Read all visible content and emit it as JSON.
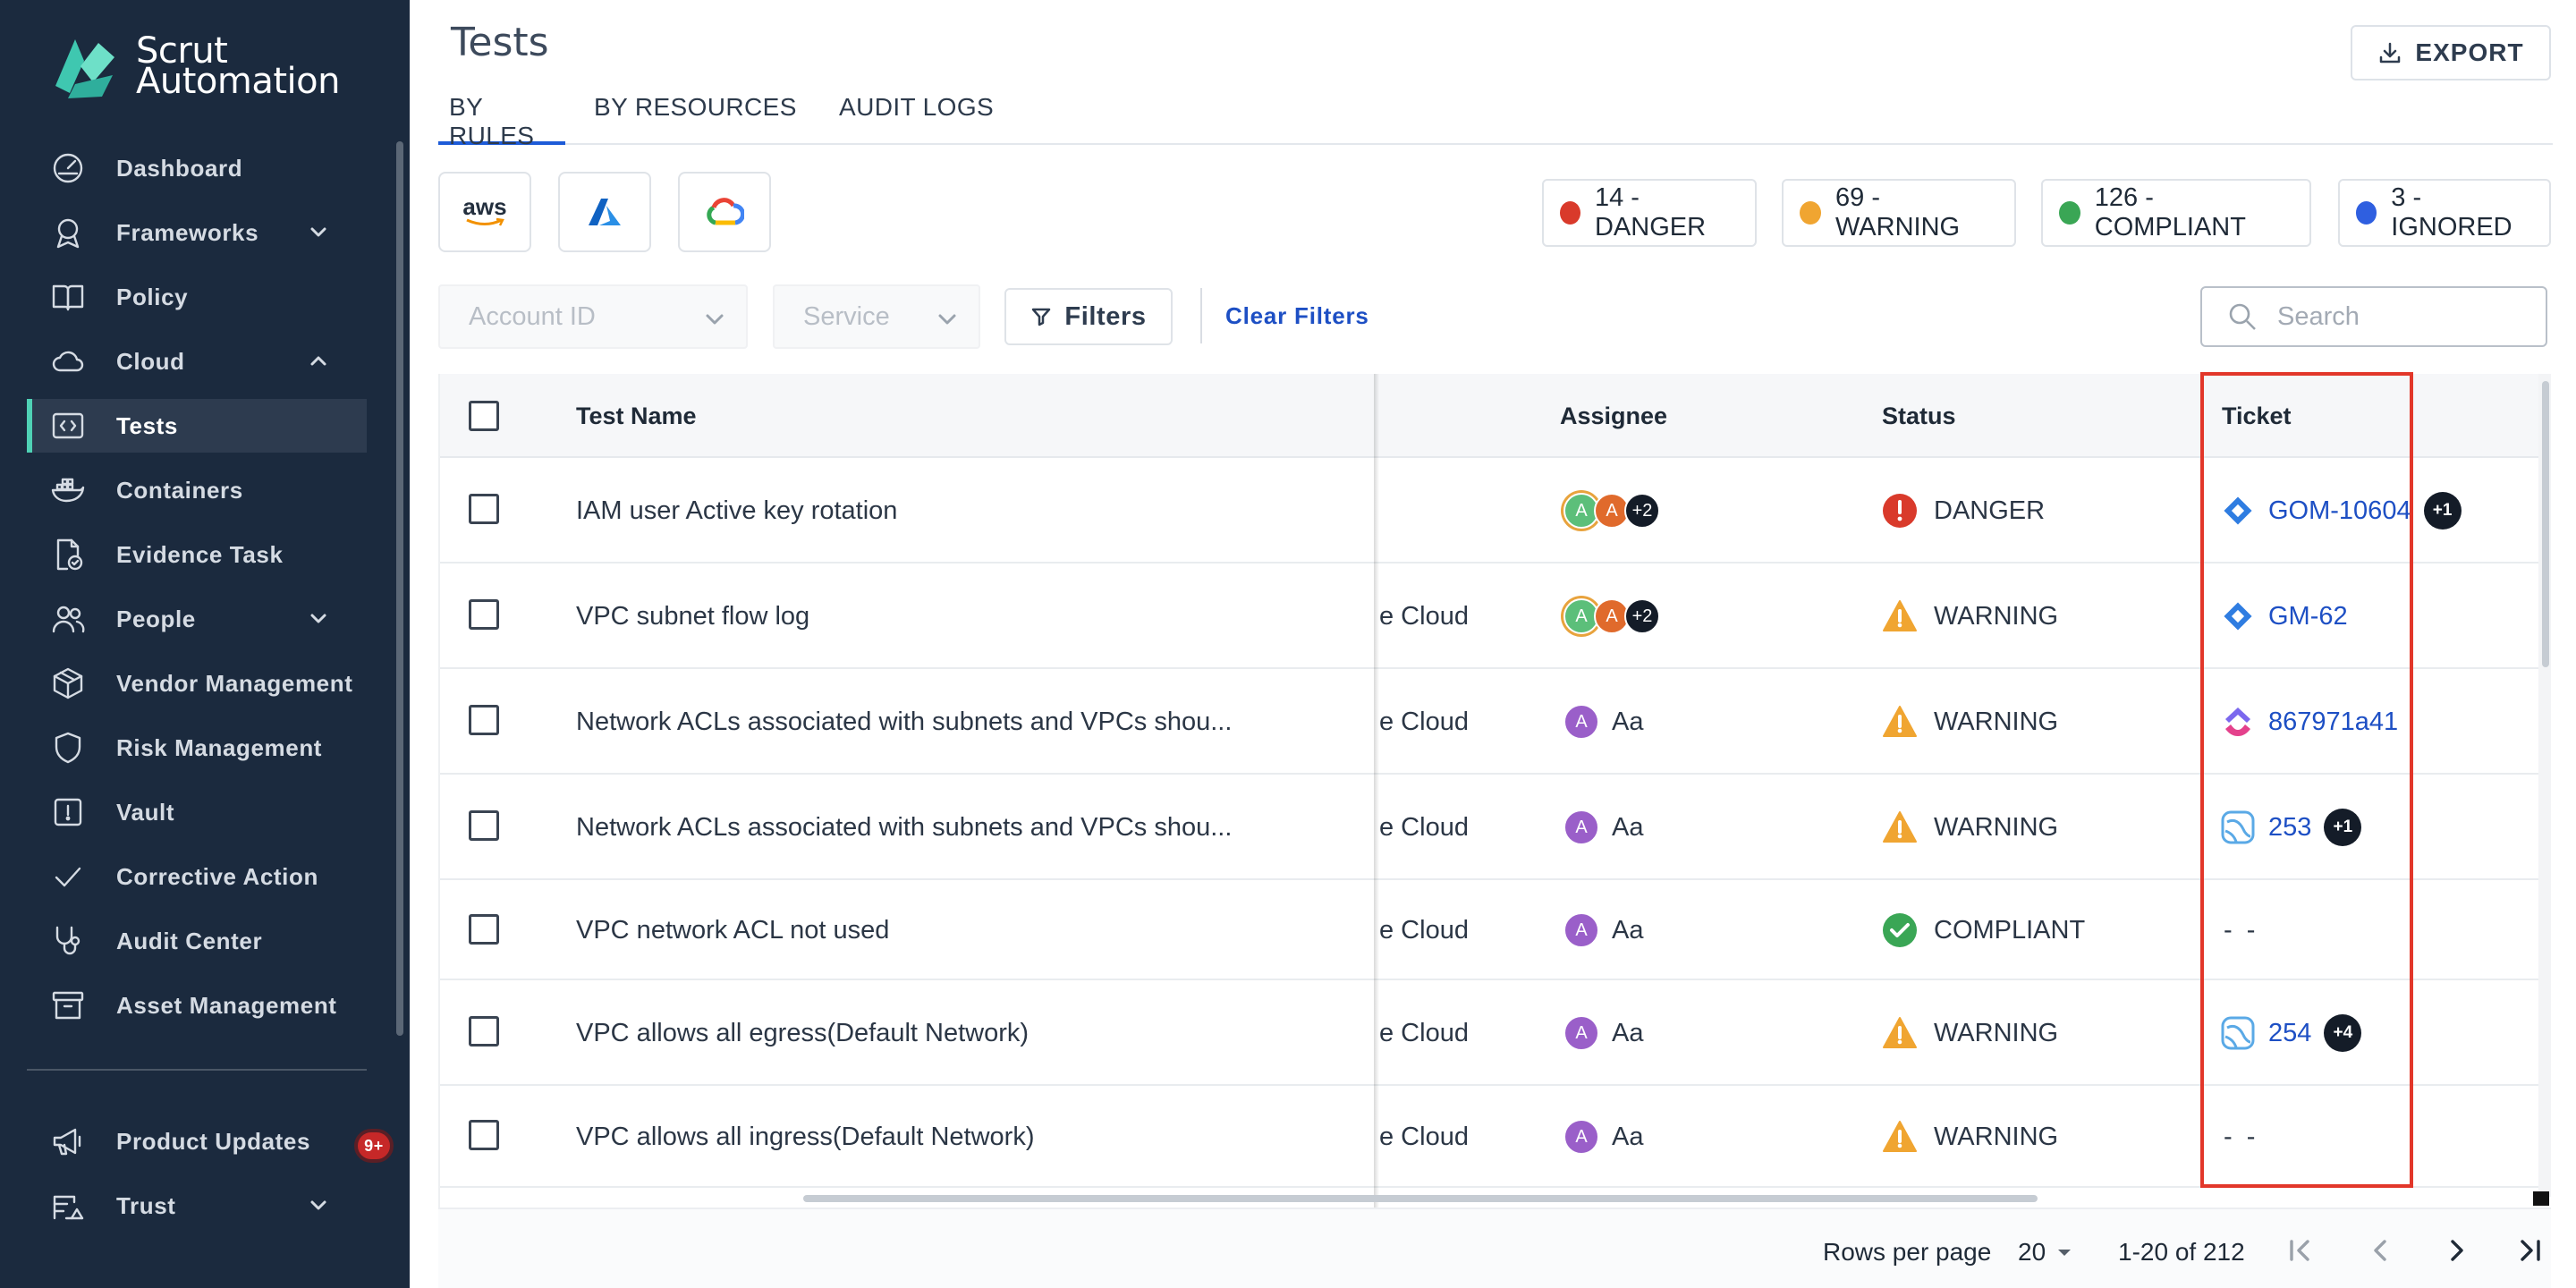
{
  "brand": {
    "line1": "Scrut",
    "line2": "Automation",
    "accent": "#4fd1b5"
  },
  "sidebar": {
    "items": [
      {
        "label": "Dashboard",
        "icon": "dashboard-icon"
      },
      {
        "label": "Frameworks",
        "icon": "award-icon",
        "expandable": true
      },
      {
        "label": "Policy",
        "icon": "book-icon"
      },
      {
        "label": "Cloud",
        "icon": "cloud-icon",
        "expanded": true
      },
      {
        "label": "Tests",
        "icon": "code-icon",
        "active": true
      },
      {
        "label": "Containers",
        "icon": "docker-icon"
      },
      {
        "label": "Evidence Task",
        "icon": "file-check-icon"
      },
      {
        "label": "People",
        "icon": "users-icon",
        "expandable": true
      },
      {
        "label": "Vendor Management",
        "icon": "box-icon"
      },
      {
        "label": "Risk Management",
        "icon": "shield-icon"
      },
      {
        "label": "Vault",
        "icon": "vault-icon"
      },
      {
        "label": "Corrective Action",
        "icon": "check-icon"
      },
      {
        "label": "Audit Center",
        "icon": "stethoscope-icon"
      },
      {
        "label": "Asset Management",
        "icon": "archive-icon"
      }
    ],
    "bottom": [
      {
        "label": "Product Updates",
        "icon": "megaphone-icon",
        "badge": "9+"
      },
      {
        "label": "Trust",
        "icon": "trust-icon",
        "expandable": true
      }
    ]
  },
  "page": {
    "title": "Tests",
    "export_label": "EXPORT",
    "tabs": [
      "BY RULES",
      "BY RESOURCES",
      "AUDIT LOGS"
    ],
    "providers": [
      "aws",
      "azure",
      "google-cloud"
    ],
    "aws_label": "aws"
  },
  "stats": [
    {
      "label": "14 - DANGER",
      "color": "#d93a2b"
    },
    {
      "label": "69 - WARNING",
      "color": "#f0a531"
    },
    {
      "label": "126 - COMPLIANT",
      "color": "#3aa655"
    },
    {
      "label": "3 - IGNORED",
      "color": "#2f5fe0"
    }
  ],
  "filters": {
    "account_placeholder": "Account ID",
    "service_placeholder": "Service",
    "filters_label": "Filters",
    "clear_label": "Clear Filters",
    "search_placeholder": "Search"
  },
  "table": {
    "headers": {
      "name": "Test Name",
      "assignee": "Assignee",
      "status": "Status",
      "ticket": "Ticket"
    },
    "rows": [
      {
        "name": "IAM user Active key rotation",
        "cloud": "",
        "assignee": {
          "type": "group",
          "extra": "+2"
        },
        "status": "DANGER",
        "ticket": {
          "source": "jira",
          "id": "GOM-10604",
          "extra": "+1"
        }
      },
      {
        "name": "VPC subnet flow log",
        "cloud": "e Cloud",
        "assignee": {
          "type": "group",
          "extra": "+2"
        },
        "status": "WARNING",
        "ticket": {
          "source": "jira",
          "id": "GM-62",
          "extra": ""
        }
      },
      {
        "name": "Network ACLs associated with subnets and VPCs shou...",
        "cloud": "e Cloud",
        "assignee": {
          "type": "single",
          "initial": "A",
          "name": "Aa"
        },
        "status": "WARNING",
        "ticket": {
          "source": "clickup",
          "id": "867971a41",
          "extra": ""
        }
      },
      {
        "name": "Network ACLs associated with subnets and VPCs shou...",
        "cloud": "e Cloud",
        "assignee": {
          "type": "single",
          "initial": "A",
          "name": "Aa"
        },
        "status": "WARNING",
        "ticket": {
          "source": "other",
          "id": "253",
          "extra": "+1"
        }
      },
      {
        "name": "VPC network ACL not used",
        "cloud": "e Cloud",
        "assignee": {
          "type": "single",
          "initial": "A",
          "name": "Aa"
        },
        "status": "COMPLIANT",
        "ticket": {
          "source": "none",
          "id": "- -",
          "extra": ""
        }
      },
      {
        "name": "VPC allows all egress(Default Network)",
        "cloud": "e Cloud",
        "assignee": {
          "type": "single",
          "initial": "A",
          "name": "Aa"
        },
        "status": "WARNING",
        "ticket": {
          "source": "other",
          "id": "254",
          "extra": "+4"
        }
      },
      {
        "name": "VPC allows all ingress(Default Network)",
        "cloud": "e Cloud",
        "assignee": {
          "type": "single",
          "initial": "A",
          "name": "Aa"
        },
        "status": "WARNING",
        "ticket": {
          "source": "none",
          "id": "- -",
          "extra": ""
        }
      }
    ]
  },
  "pagination": {
    "rows_label": "Rows per page",
    "rows_value": "20",
    "range": "1-20 of 212"
  }
}
